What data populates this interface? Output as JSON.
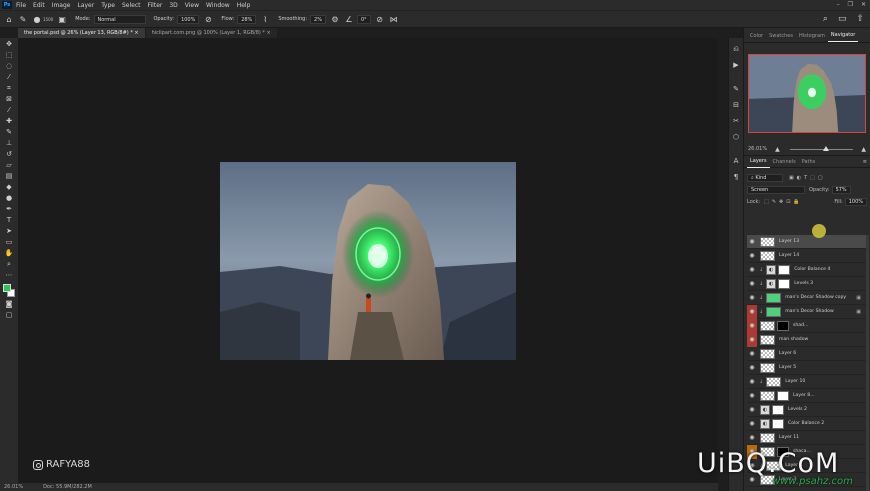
{
  "menu": {
    "logo": "Ps",
    "items": [
      "File",
      "Edit",
      "Image",
      "Layer",
      "Type",
      "Select",
      "Filter",
      "3D",
      "View",
      "Window",
      "Help"
    ],
    "window_controls": [
      "–",
      "❐",
      "✕"
    ]
  },
  "options_bar": {
    "brush_size": "1500",
    "mode_label": "Mode:",
    "mode_value": "Normal",
    "opacity_label": "Opacity:",
    "opacity_value": "100%",
    "flow_label": "Flow:",
    "flow_value": "28%",
    "smoothing_label": "Smoothing:",
    "smoothing_value": "2%",
    "angle_value": "0°"
  },
  "doc_tabs": [
    {
      "label": "the portal.psd @ 26% (Layer 13, RGB/8#) *",
      "active": true
    },
    {
      "label": "hiclipart.com.png @ 100% (Layer 1, RGB/8) *",
      "active": false
    }
  ],
  "status_bar": {
    "zoom": "26.01%",
    "doc": "Doc: 55.9M/282.2M"
  },
  "watermark": {
    "handle": "RAFYA88"
  },
  "right_panel": {
    "tabs": [
      "Color",
      "Swatches",
      "Histogram",
      "Navigator"
    ],
    "active_tab": "Navigator",
    "nav_zoom": "26.01%",
    "layer_tabs": [
      "Layers",
      "Channels",
      "Paths"
    ],
    "active_layer_tab": "Layers",
    "filter_label": "Kind",
    "blend_mode": "Screen",
    "opacity_label": "Opacity:",
    "opacity_value": "57%",
    "lock_label": "Lock:",
    "fill_label": "Fill:",
    "fill_value": "100%",
    "layers": [
      {
        "name": "Layer 13",
        "thumb": "check",
        "selected": true,
        "eye": "normal"
      },
      {
        "name": "Layer 14",
        "thumb": "check",
        "eye": "normal"
      },
      {
        "name": "Color Balance 4",
        "thumb": "adj",
        "mask": "white",
        "clip": true,
        "eye": "normal"
      },
      {
        "name": "Levels 3",
        "thumb": "adj",
        "mask": "white",
        "clip": true,
        "eye": "normal"
      },
      {
        "name": "man's Decor Shadow copy",
        "thumb": "green",
        "clip": true,
        "fx": true,
        "eye": "normal"
      },
      {
        "name": "man's Decor Shadow",
        "thumb": "green",
        "clip": true,
        "fx": true,
        "eye": "red"
      },
      {
        "name": "shad...",
        "thumb": "check",
        "mask": "black",
        "eye": "red"
      },
      {
        "name": "man shadow",
        "thumb": "check",
        "eye": "red"
      },
      {
        "name": "Layer 6",
        "thumb": "check",
        "eye": "normal"
      },
      {
        "name": "Layer 5",
        "thumb": "check",
        "eye": "normal"
      },
      {
        "name": "Layer 10",
        "thumb": "check",
        "clip": true,
        "eye": "normal"
      },
      {
        "name": "Layer 8...",
        "thumb": "check",
        "mask": "white",
        "eye": "normal"
      },
      {
        "name": "Levels 2",
        "thumb": "adj",
        "mask": "white",
        "eye": "normal"
      },
      {
        "name": "Color Balance 2",
        "thumb": "adj",
        "mask": "white",
        "eye": "normal"
      },
      {
        "name": "Layer 11",
        "thumb": "check",
        "eye": "normal"
      },
      {
        "name": "shaca...",
        "thumb": "check",
        "mask": "black",
        "eye": "orange"
      },
      {
        "name": "Layer 4",
        "thumb": "check",
        "clip": true,
        "eye": "normal"
      },
      {
        "name": "Layer 3",
        "thumb": "check",
        "eye": "normal"
      }
    ]
  },
  "site_logo": {
    "main": "UiBQ.CoM",
    "sub": "www.psahz.com"
  }
}
